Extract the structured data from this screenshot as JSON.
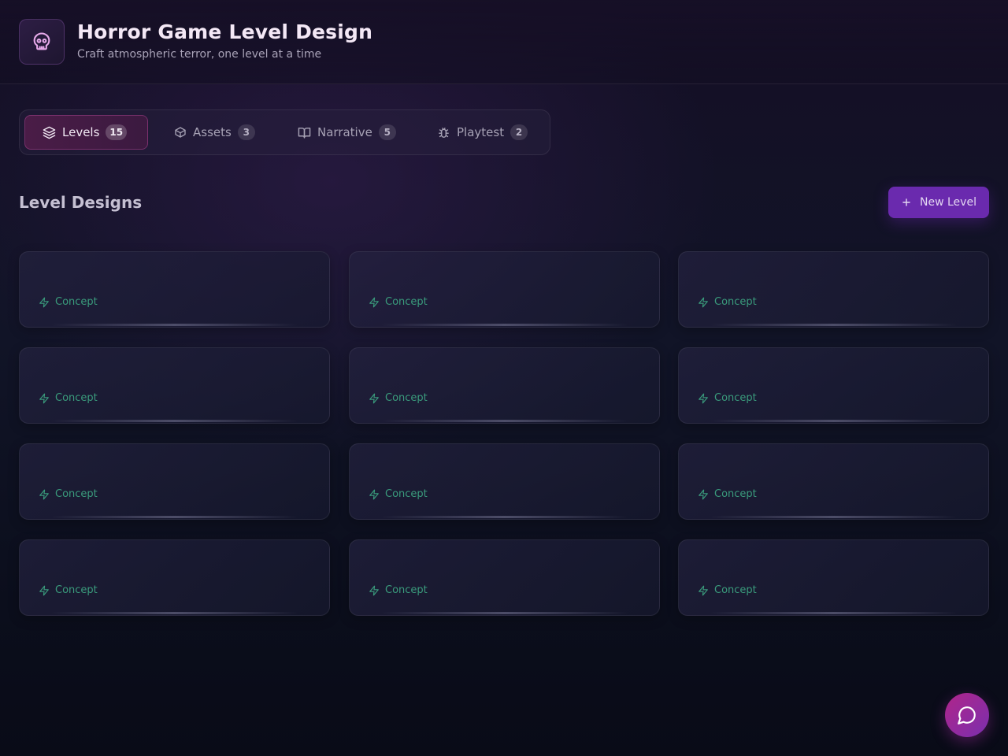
{
  "header": {
    "title": "Horror Game Level Design",
    "subtitle": "Craft atmospheric terror, one level at a time",
    "logo_icon": "skull-icon"
  },
  "tabs": [
    {
      "label": "Levels",
      "count": "15",
      "icon": "layers-icon",
      "active": true
    },
    {
      "label": "Assets",
      "count": "3",
      "icon": "box-icon",
      "active": false
    },
    {
      "label": "Narrative",
      "count": "5",
      "icon": "book-icon",
      "active": false
    },
    {
      "label": "Playtest",
      "count": "2",
      "icon": "bug-icon",
      "active": false
    }
  ],
  "section": {
    "title": "Level Designs",
    "new_button_label": "New Level"
  },
  "cards": [
    {
      "status": "Concept"
    },
    {
      "status": "Concept"
    },
    {
      "status": "Concept"
    },
    {
      "status": "Concept"
    },
    {
      "status": "Concept"
    },
    {
      "status": "Concept"
    },
    {
      "status": "Concept"
    },
    {
      "status": "Concept"
    },
    {
      "status": "Concept"
    },
    {
      "status": "Concept"
    },
    {
      "status": "Concept"
    },
    {
      "status": "Concept"
    }
  ],
  "colors": {
    "accent": "#6a2aae",
    "status_concept": "#3a9b7c",
    "active_tab": "#4a1c47"
  },
  "fab_icon": "chat-bubble-icon"
}
